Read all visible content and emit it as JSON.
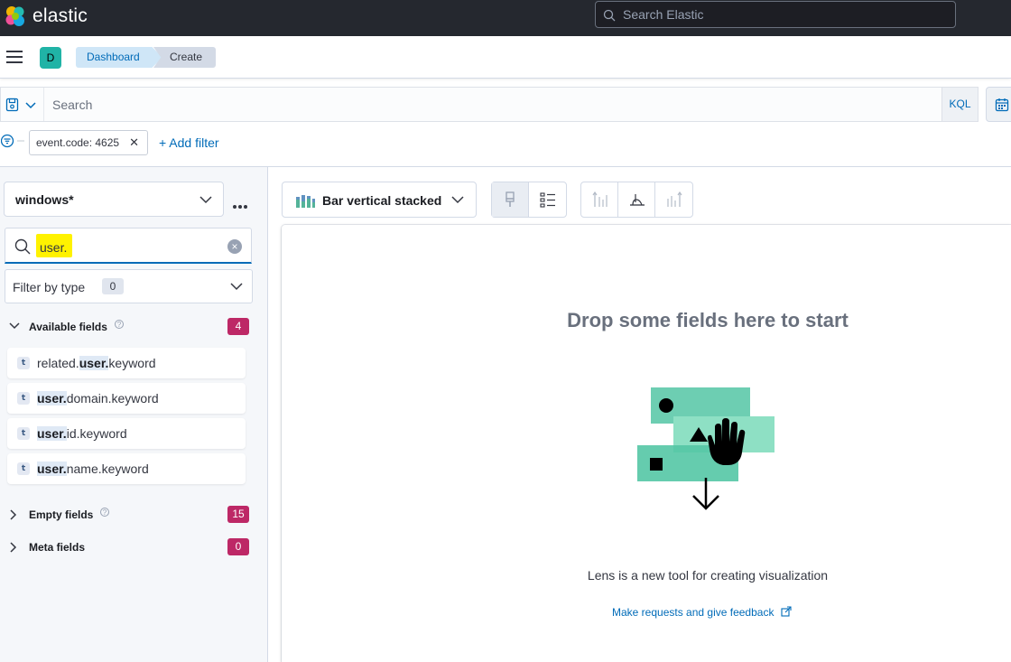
{
  "header": {
    "brand": "elastic",
    "search_placeholder": "Search Elastic"
  },
  "nav": {
    "space_initial": "D",
    "breadcrumbs": [
      "Dashboard",
      "Create"
    ]
  },
  "query": {
    "placeholder": "Search",
    "language": "KQL"
  },
  "filters": {
    "pills": [
      "event.code: 4625"
    ],
    "add_label": "+ Add filter"
  },
  "sidebar": {
    "index_pattern": "windows*",
    "field_search_value": "user.",
    "filter_by_type_label": "Filter by type",
    "filter_by_type_count": "0",
    "available": {
      "title": "Available fields",
      "count": "4",
      "fields": [
        {
          "prefix": "related.",
          "match": "user.",
          "suffix": "keyword"
        },
        {
          "prefix": "",
          "match": "user.",
          "suffix": "domain.keyword"
        },
        {
          "prefix": "",
          "match": "user.",
          "suffix": "id.keyword"
        },
        {
          "prefix": "",
          "match": "user.",
          "suffix": "name.keyword"
        }
      ],
      "field_type_token": "t"
    },
    "empty": {
      "title": "Empty fields",
      "count": "15"
    },
    "meta": {
      "title": "Meta fields",
      "count": "0"
    }
  },
  "toolbar": {
    "chart_type": "Bar vertical stacked"
  },
  "workspace": {
    "title": "Drop some fields here to start",
    "description": "Lens is a new tool for creating visualization",
    "feedback_link": "Make requests and give feedback"
  },
  "colors": {
    "accent": "#006bb8",
    "badge": "#bd2866",
    "highlight": "#fff200",
    "header_bg": "#25282f"
  }
}
